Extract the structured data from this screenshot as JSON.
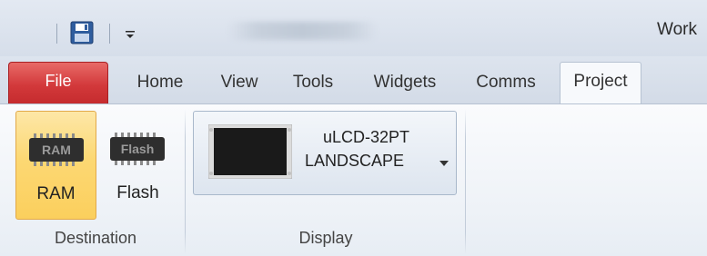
{
  "title_bar": {
    "title": "Work",
    "quick_access": [
      {
        "icon": "save-icon"
      },
      {
        "icon": "customize-dropdown-icon"
      }
    ]
  },
  "tabs": {
    "file": "File",
    "items": [
      "Home",
      "View",
      "Tools",
      "Widgets",
      "Comms"
    ],
    "active": "Project"
  },
  "ribbon": {
    "destination": {
      "label": "Destination",
      "ram": {
        "label": "RAM",
        "icon_text": "RAM",
        "selected": true
      },
      "flash": {
        "label": "Flash",
        "icon_text": "Flash",
        "selected": false
      }
    },
    "display": {
      "label": "Display",
      "device_line1": "uLCD-32PT",
      "device_line2": "LANDSCAPE"
    }
  },
  "colors": {
    "file_tab": "#d2383a",
    "selected_button": "#fcd873",
    "ribbon_bg": "#f4f7fb"
  }
}
